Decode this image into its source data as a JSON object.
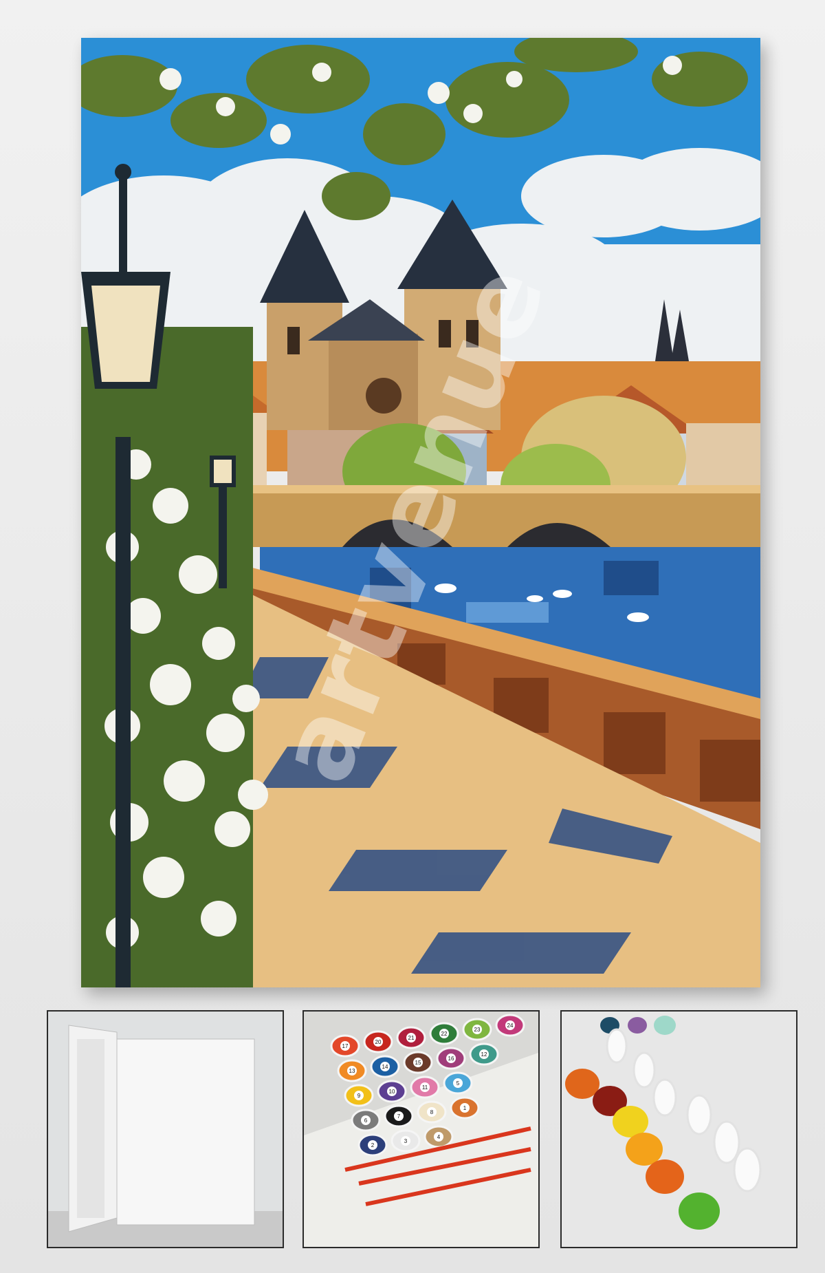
{
  "watermark": {
    "text": "artvenue"
  },
  "colors": {
    "sky": "#2b8fd6",
    "cloud": "#eef1f3",
    "river": "#2f6fb8",
    "stone": "#c79a55",
    "wall": "#a85a2a",
    "blossom": "#f4f4ee",
    "leaf": "#5e7a2e"
  },
  "thumbnails": [
    {
      "name": "blank-canvas",
      "caption": ""
    },
    {
      "name": "numbered-paint-pots",
      "numbers": [
        "17",
        "20",
        "21",
        "22",
        "23",
        "24",
        "13",
        "14",
        "15",
        "16",
        "12",
        "9",
        "10",
        "11",
        "5",
        "6",
        "7",
        "8",
        "1",
        "2",
        "3",
        "4"
      ]
    },
    {
      "name": "open-paint-pots",
      "caption": ""
    }
  ]
}
